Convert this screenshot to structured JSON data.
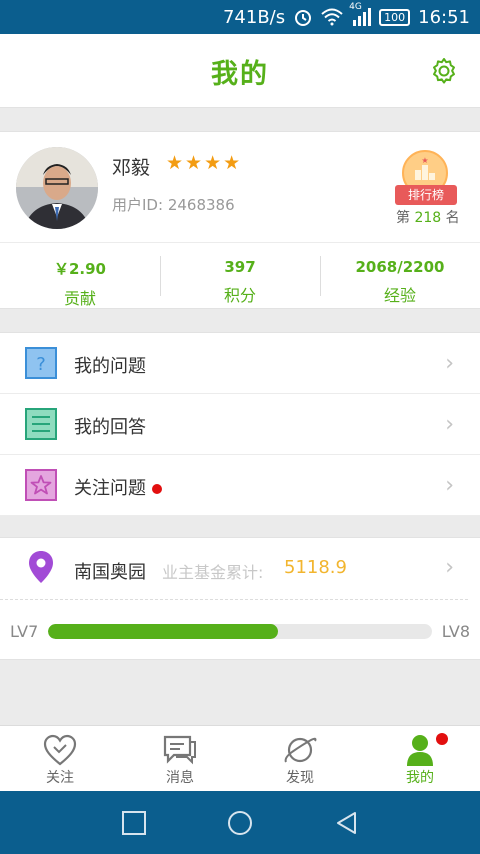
{
  "status_bar": {
    "speed": "741B/s",
    "network": "4G",
    "battery": "100",
    "time": "16:51"
  },
  "header": {
    "title": "我的"
  },
  "profile": {
    "name": "邓毅",
    "stars": "★★★★",
    "user_id_label": "用户ID:",
    "user_id": "2468386",
    "rank_badge": "排行榜",
    "rank_prefix": "第",
    "rank_number": "218",
    "rank_suffix": "名"
  },
  "stats": [
    {
      "value": "￥2.90",
      "label": "贡献"
    },
    {
      "value": "397",
      "label": "积分"
    },
    {
      "value": "2068/2200",
      "label": "经验"
    }
  ],
  "menu": [
    {
      "label": "我的问题",
      "icon": "question-icon",
      "color": "#3b8fd8"
    },
    {
      "label": "我的回答",
      "icon": "answer-list-icon",
      "color": "#27a57a"
    },
    {
      "label": "关注问题",
      "icon": "star-box-icon",
      "color": "#c04fb6",
      "has_dot": true
    }
  ],
  "community": {
    "name": "南国奥园",
    "fund_label": "业主基金累计:",
    "fund_value": "5118.9",
    "level_current": "LV7",
    "level_next": "LV8",
    "progress_fraction": 0.6
  },
  "tabs": [
    {
      "label": "关注",
      "icon": "heart-icon",
      "active": false
    },
    {
      "label": "消息",
      "icon": "message-icon",
      "active": false
    },
    {
      "label": "发现",
      "icon": "planet-icon",
      "active": false
    },
    {
      "label": "我的",
      "icon": "person-icon",
      "active": true,
      "has_dot": true
    }
  ],
  "colors": {
    "accent": "#56b01a",
    "status_bar": "#0b5e8e",
    "fund_value": "#f2b52e",
    "notification_dot": "#e20f0f"
  }
}
